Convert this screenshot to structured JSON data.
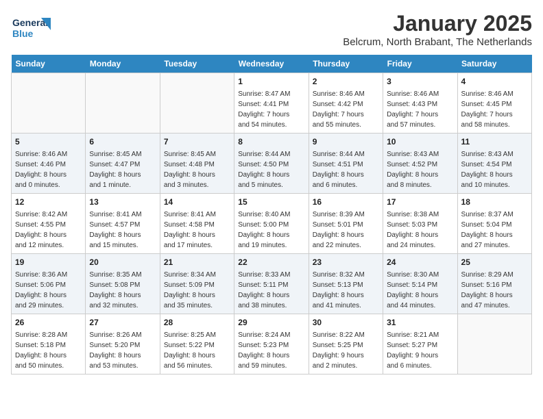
{
  "header": {
    "logo_line1": "General",
    "logo_line2": "Blue",
    "title": "January 2025",
    "location": "Belcrum, North Brabant, The Netherlands"
  },
  "weekdays": [
    "Sunday",
    "Monday",
    "Tuesday",
    "Wednesday",
    "Thursday",
    "Friday",
    "Saturday"
  ],
  "weeks": [
    [
      {
        "day": "",
        "info": ""
      },
      {
        "day": "",
        "info": ""
      },
      {
        "day": "",
        "info": ""
      },
      {
        "day": "1",
        "info": "Sunrise: 8:47 AM\nSunset: 4:41 PM\nDaylight: 7 hours\nand 54 minutes."
      },
      {
        "day": "2",
        "info": "Sunrise: 8:46 AM\nSunset: 4:42 PM\nDaylight: 7 hours\nand 55 minutes."
      },
      {
        "day": "3",
        "info": "Sunrise: 8:46 AM\nSunset: 4:43 PM\nDaylight: 7 hours\nand 57 minutes."
      },
      {
        "day": "4",
        "info": "Sunrise: 8:46 AM\nSunset: 4:45 PM\nDaylight: 7 hours\nand 58 minutes."
      }
    ],
    [
      {
        "day": "5",
        "info": "Sunrise: 8:46 AM\nSunset: 4:46 PM\nDaylight: 8 hours\nand 0 minutes."
      },
      {
        "day": "6",
        "info": "Sunrise: 8:45 AM\nSunset: 4:47 PM\nDaylight: 8 hours\nand 1 minute."
      },
      {
        "day": "7",
        "info": "Sunrise: 8:45 AM\nSunset: 4:48 PM\nDaylight: 8 hours\nand 3 minutes."
      },
      {
        "day": "8",
        "info": "Sunrise: 8:44 AM\nSunset: 4:50 PM\nDaylight: 8 hours\nand 5 minutes."
      },
      {
        "day": "9",
        "info": "Sunrise: 8:44 AM\nSunset: 4:51 PM\nDaylight: 8 hours\nand 6 minutes."
      },
      {
        "day": "10",
        "info": "Sunrise: 8:43 AM\nSunset: 4:52 PM\nDaylight: 8 hours\nand 8 minutes."
      },
      {
        "day": "11",
        "info": "Sunrise: 8:43 AM\nSunset: 4:54 PM\nDaylight: 8 hours\nand 10 minutes."
      }
    ],
    [
      {
        "day": "12",
        "info": "Sunrise: 8:42 AM\nSunset: 4:55 PM\nDaylight: 8 hours\nand 12 minutes."
      },
      {
        "day": "13",
        "info": "Sunrise: 8:41 AM\nSunset: 4:57 PM\nDaylight: 8 hours\nand 15 minutes."
      },
      {
        "day": "14",
        "info": "Sunrise: 8:41 AM\nSunset: 4:58 PM\nDaylight: 8 hours\nand 17 minutes."
      },
      {
        "day": "15",
        "info": "Sunrise: 8:40 AM\nSunset: 5:00 PM\nDaylight: 8 hours\nand 19 minutes."
      },
      {
        "day": "16",
        "info": "Sunrise: 8:39 AM\nSunset: 5:01 PM\nDaylight: 8 hours\nand 22 minutes."
      },
      {
        "day": "17",
        "info": "Sunrise: 8:38 AM\nSunset: 5:03 PM\nDaylight: 8 hours\nand 24 minutes."
      },
      {
        "day": "18",
        "info": "Sunrise: 8:37 AM\nSunset: 5:04 PM\nDaylight: 8 hours\nand 27 minutes."
      }
    ],
    [
      {
        "day": "19",
        "info": "Sunrise: 8:36 AM\nSunset: 5:06 PM\nDaylight: 8 hours\nand 29 minutes."
      },
      {
        "day": "20",
        "info": "Sunrise: 8:35 AM\nSunset: 5:08 PM\nDaylight: 8 hours\nand 32 minutes."
      },
      {
        "day": "21",
        "info": "Sunrise: 8:34 AM\nSunset: 5:09 PM\nDaylight: 8 hours\nand 35 minutes."
      },
      {
        "day": "22",
        "info": "Sunrise: 8:33 AM\nSunset: 5:11 PM\nDaylight: 8 hours\nand 38 minutes."
      },
      {
        "day": "23",
        "info": "Sunrise: 8:32 AM\nSunset: 5:13 PM\nDaylight: 8 hours\nand 41 minutes."
      },
      {
        "day": "24",
        "info": "Sunrise: 8:30 AM\nSunset: 5:14 PM\nDaylight: 8 hours\nand 44 minutes."
      },
      {
        "day": "25",
        "info": "Sunrise: 8:29 AM\nSunset: 5:16 PM\nDaylight: 8 hours\nand 47 minutes."
      }
    ],
    [
      {
        "day": "26",
        "info": "Sunrise: 8:28 AM\nSunset: 5:18 PM\nDaylight: 8 hours\nand 50 minutes."
      },
      {
        "day": "27",
        "info": "Sunrise: 8:26 AM\nSunset: 5:20 PM\nDaylight: 8 hours\nand 53 minutes."
      },
      {
        "day": "28",
        "info": "Sunrise: 8:25 AM\nSunset: 5:22 PM\nDaylight: 8 hours\nand 56 minutes."
      },
      {
        "day": "29",
        "info": "Sunrise: 8:24 AM\nSunset: 5:23 PM\nDaylight: 8 hours\nand 59 minutes."
      },
      {
        "day": "30",
        "info": "Sunrise: 8:22 AM\nSunset: 5:25 PM\nDaylight: 9 hours\nand 2 minutes."
      },
      {
        "day": "31",
        "info": "Sunrise: 8:21 AM\nSunset: 5:27 PM\nDaylight: 9 hours\nand 6 minutes."
      },
      {
        "day": "",
        "info": ""
      }
    ]
  ]
}
